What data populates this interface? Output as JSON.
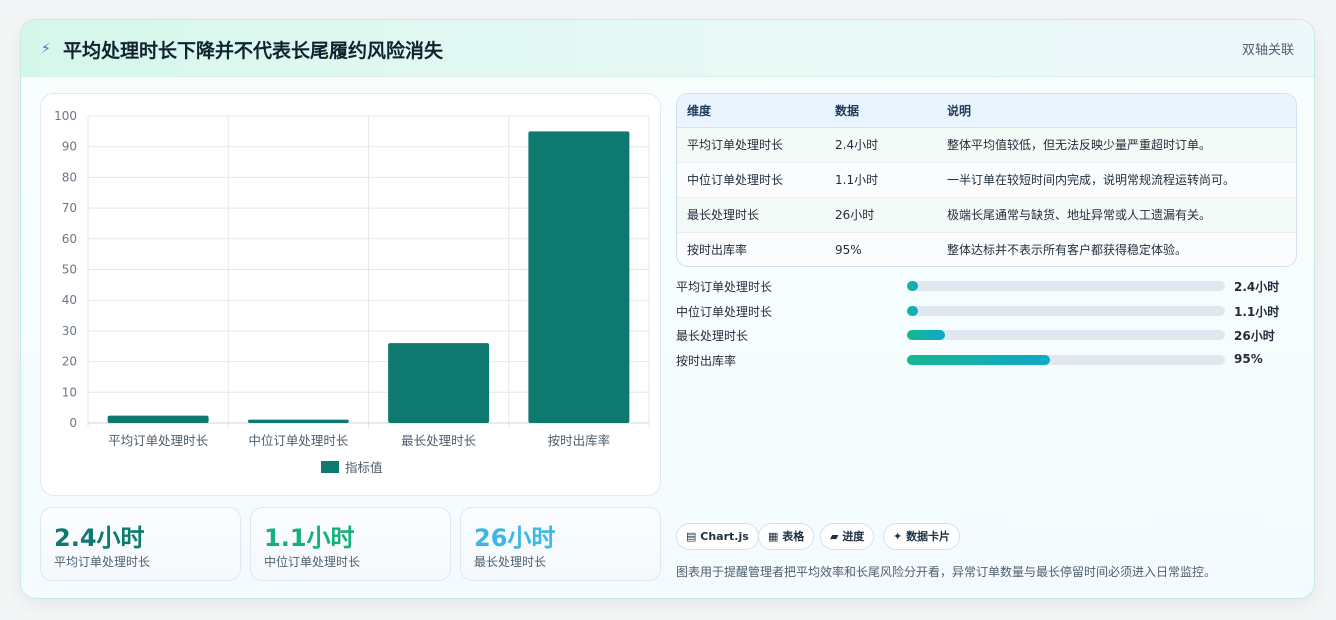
{
  "header": {
    "icon": "lightning-icon",
    "title": "平均处理时长下降并不代表长尾履约风险消失",
    "link": "双轴关联"
  },
  "chart_data": {
    "type": "bar",
    "categories": [
      "平均订单处理时长",
      "中位订单处理时长",
      "最长处理时长",
      "按时出库率"
    ],
    "series": [
      {
        "name": "指标值",
        "values": [
          2.4,
          1.1,
          26,
          95
        ],
        "color": "#0e7a6f"
      }
    ],
    "ylim": [
      0,
      100
    ],
    "yticks": [
      "0",
      "10",
      "20",
      "30",
      "40",
      "50",
      "60",
      "70",
      "80",
      "90",
      "100"
    ],
    "grid": true,
    "legend": "bottom"
  },
  "stats": [
    {
      "value": "2.4小时",
      "label": "平均订单处理时长",
      "color": "#0e7a6f"
    },
    {
      "value": "1.1小时",
      "label": "中位订单处理时长",
      "color": "#16b07a"
    },
    {
      "value": "26小时",
      "label": "最长处理时长",
      "color": "#3db7e4"
    }
  ],
  "table": {
    "headers": [
      "维度",
      "数据",
      "说明"
    ],
    "rows": [
      [
        "平均订单处理时长",
        "2.4小时",
        "整体平均值较低，但无法反映少量严重超时订单。"
      ],
      [
        "中位订单处理时长",
        "1.1小时",
        "一半订单在较短时间内完成，说明常规流程运转尚可。"
      ],
      [
        "最长处理时长",
        "26小时",
        "极端长尾通常与缺货、地址异常或人工遗漏有关。"
      ],
      [
        "按时出库率",
        "95%",
        "整体达标并不表示所有客户都获得稳定体验。"
      ]
    ]
  },
  "progress": [
    {
      "label": "平均订单处理时长",
      "value": "2.4小时",
      "percent": 2.4
    },
    {
      "label": "中位订单处理时长",
      "value": "1.1小时",
      "percent": 1.1
    },
    {
      "label": "最长处理时长",
      "value": "26小时",
      "percent": 12
    },
    {
      "label": "按时出库率",
      "value": "95%",
      "percent": 45
    }
  ],
  "tags": [
    {
      "icon": "chart-icon",
      "glyph": "▤",
      "label": "Chart.js"
    },
    {
      "icon": "table-icon",
      "glyph": "▦",
      "label": "表格"
    },
    {
      "icon": "progress-icon",
      "glyph": "▰",
      "label": "进度"
    },
    {
      "icon": "sparkle-icon",
      "glyph": "✦",
      "label": "数据卡片"
    }
  ],
  "footnote": "图表用于提醒管理者把平均效率和长尾风险分开看，异常订单数量与最长停留时间必须进入日常监控。"
}
